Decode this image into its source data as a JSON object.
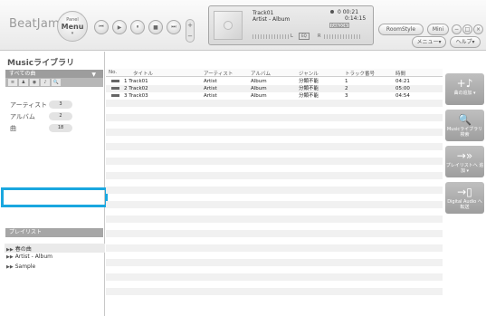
{
  "app": {
    "logo": "BeatJam"
  },
  "panel_button": {
    "line1": "Panel",
    "line2": "Menu",
    "line3": "▾"
  },
  "transport": {
    "prev": "⏮",
    "play": "▶",
    "pause": "⏸",
    "stop": "■",
    "next": "⏭",
    "vol_up": "+",
    "vol_down": "−"
  },
  "now_playing": {
    "title": "Track01",
    "subtitle": "Artist - Album",
    "time_elapsed": "0 00:21",
    "time_total": "0:14:15",
    "mode_label": "RANDOM",
    "eq_label": "EQ",
    "left_label": "L",
    "right_label": "R"
  },
  "top_right": {
    "roomstyle": "RoomStyle",
    "mini": "Mini",
    "menu": "メニュー▾",
    "help": "ヘルプ▾"
  },
  "sidebar": {
    "title": "Musicライブラリ",
    "all_songs": "すべての曲",
    "categories": [
      {
        "label": "アーティスト",
        "count": "3"
      },
      {
        "label": "アルバム",
        "count": "2"
      },
      {
        "label": "曲",
        "count": "18"
      }
    ],
    "playlist_header": "プレイリスト",
    "playlists": [
      "春の曲",
      "Artist - Album",
      "Sample"
    ]
  },
  "table": {
    "headers": [
      "No.",
      "タイトル",
      "アーティスト",
      "アルバム",
      "ジャンル",
      "トラック番号",
      "時間"
    ],
    "rows": [
      {
        "title": "1 Track01",
        "artist": "Artist",
        "album": "Album",
        "genre": "分類不能",
        "track": "1",
        "time": "04:21"
      },
      {
        "title": "2 Track02",
        "artist": "Artist",
        "album": "Album",
        "genre": "分類不能",
        "track": "2",
        "time": "05:00"
      },
      {
        "title": "3 Track03",
        "artist": "Artist",
        "album": "Album",
        "genre": "分類不能",
        "track": "3",
        "time": "04:54"
      }
    ]
  },
  "actions": [
    {
      "icon": "+♪",
      "label": "曲の追加 ▾"
    },
    {
      "icon": "🔍",
      "label": "Musicライブラリ 検索"
    },
    {
      "icon": "→»",
      "label": "プレイリストへ 追加 ▾"
    },
    {
      "icon": "→▯",
      "label": "Digital Audio へ転送"
    }
  ],
  "colors": {
    "highlight": "#1aa7df",
    "sidebar_header": "#9d9d9d",
    "action_button": "#aaaaaa"
  }
}
